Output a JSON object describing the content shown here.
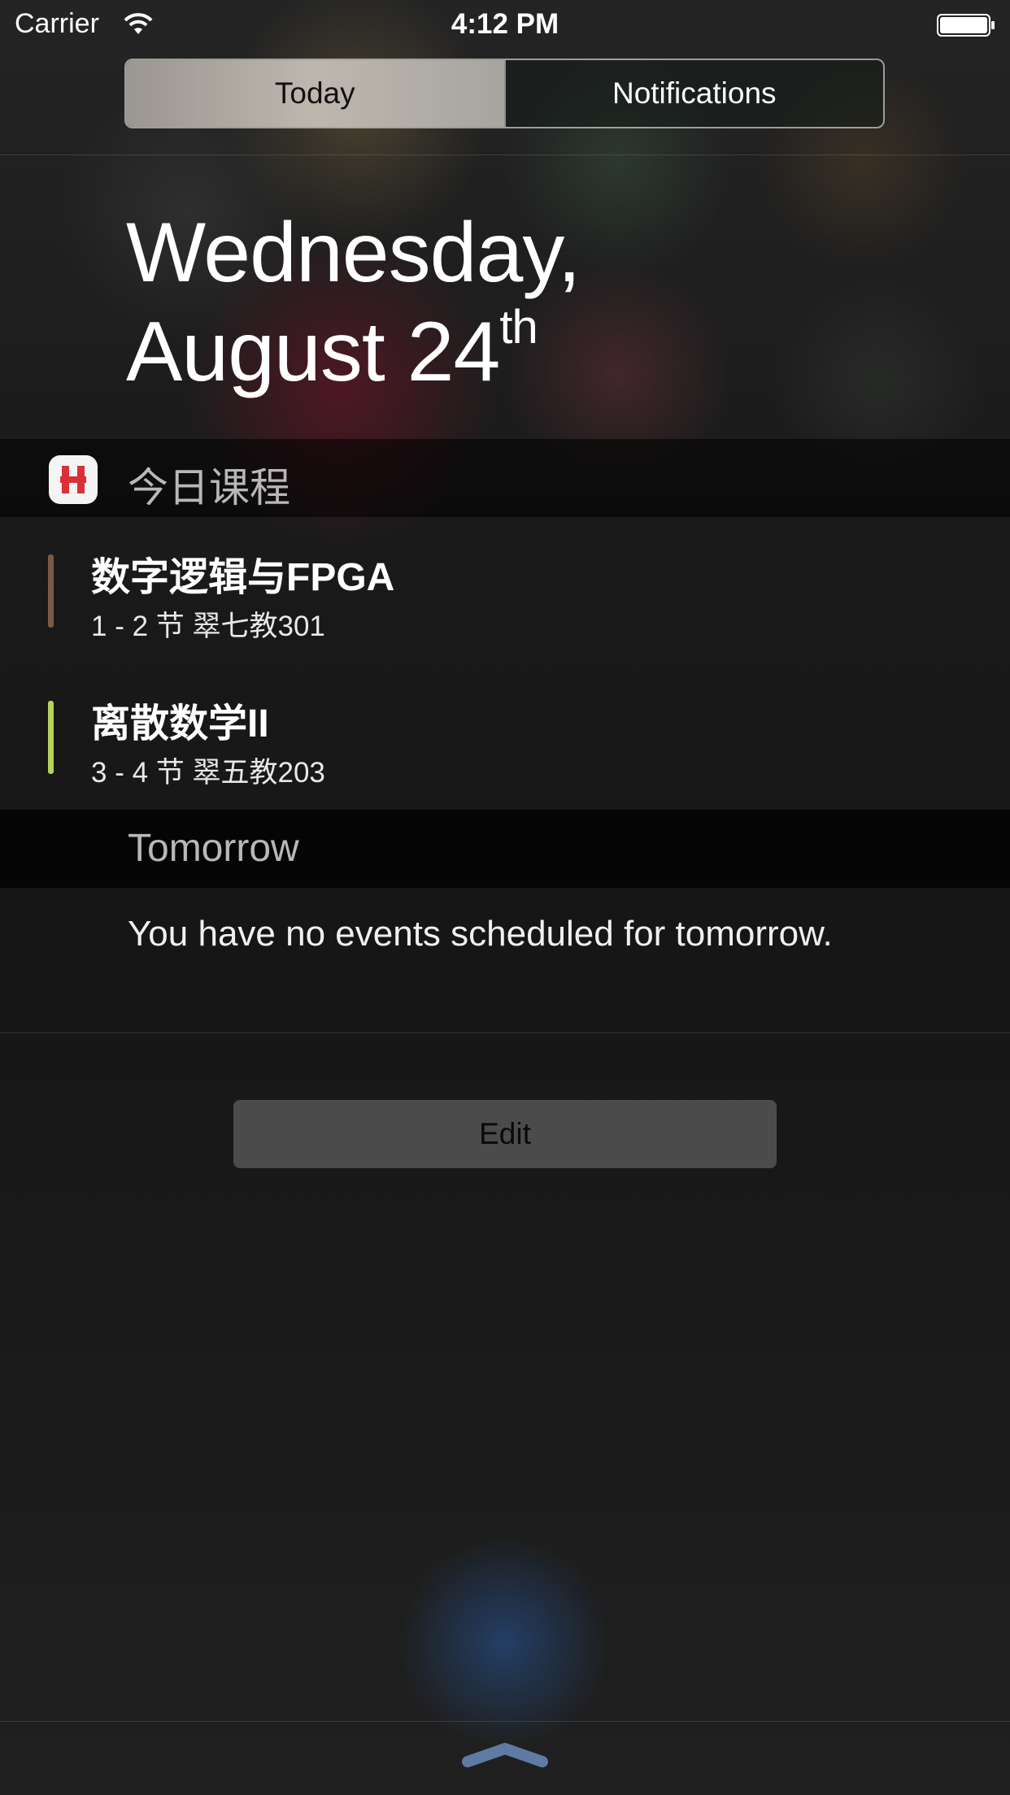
{
  "status_bar": {
    "carrier": "Carrier",
    "time": "4:12 PM",
    "icons": [
      "wifi-icon",
      "battery-icon"
    ]
  },
  "segmented_control": {
    "tabs": [
      {
        "label": "Today",
        "selected": true
      },
      {
        "label": "Notifications",
        "selected": false
      }
    ]
  },
  "date": {
    "line1": "Wednesday,",
    "line2": "August 24",
    "suffix": "th"
  },
  "widget": {
    "title": "今日课程",
    "app_icon": "h-app-icon",
    "app_icon_letter": "H",
    "courses": [
      {
        "name": "数字逻辑与FPGA",
        "detail": "1 - 2 节  翠七教301",
        "color": "#7a5a44"
      },
      {
        "name": "离散数学II",
        "detail": "3 - 4 节  翠五教203",
        "color": "#b4d35a"
      }
    ]
  },
  "tomorrow": {
    "label": "Tomorrow",
    "message": "You have no events scheduled for tomorrow."
  },
  "edit": {
    "label": "Edit"
  },
  "colors": {
    "accent_red": "#d9303a",
    "segment_selected": "#b5b0a8",
    "edit_button": "#4b4b4b"
  }
}
